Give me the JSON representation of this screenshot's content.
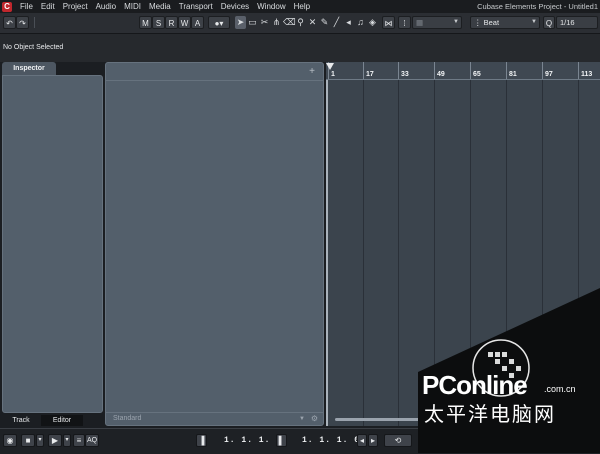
{
  "menu": {
    "items": [
      "File",
      "Edit",
      "Project",
      "Audio",
      "MIDI",
      "Media",
      "Transport",
      "Devices",
      "Window",
      "Help"
    ],
    "window_title": "Cubase Elements Project - Untitled1"
  },
  "toolbar": {
    "undo": "↶",
    "redo": "↷",
    "modes": [
      "M",
      "S",
      "R",
      "W",
      "A"
    ],
    "snap_label": "Beat",
    "quantize_label": "Q",
    "quantize_value": "1/16"
  },
  "info_line": {
    "status": "No Object Selected"
  },
  "inspector": {
    "title": "Inspector",
    "tabs": [
      "Track",
      "Editor"
    ]
  },
  "track_list": {
    "add_icon": "+",
    "preset": "Standard"
  },
  "ruler": {
    "bars": [
      "1",
      "17",
      "33",
      "49",
      "65",
      "81",
      "97",
      "113"
    ]
  },
  "transport": {
    "left_position": "1. 1. 1.   0",
    "right_position": "1. 1. 1.   0",
    "aq": "AQ"
  },
  "watermark": {
    "brand": "PConline",
    "domain": ".com.cn",
    "subtitle": "太平洋电脑网"
  }
}
